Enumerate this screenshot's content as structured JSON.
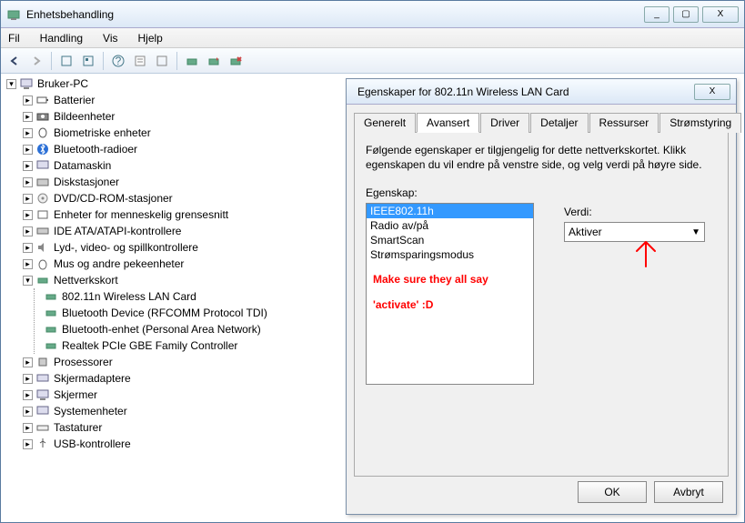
{
  "main": {
    "title": "Enhetsbehandling",
    "menu": {
      "fil": "Fil",
      "handling": "Handling",
      "vis": "Vis",
      "hjelp": "Hjelp"
    },
    "win_btns": {
      "min": "_",
      "max": "▢",
      "close": "X"
    }
  },
  "tree": {
    "root": "Bruker-PC",
    "batterier": "Batterier",
    "bildeenheter": "Bildeenheter",
    "biometriske": "Biometriske enheter",
    "bluetooth_radioer": "Bluetooth-radioer",
    "datamaskin": "Datamaskin",
    "diskstasjoner": "Diskstasjoner",
    "dvd": "DVD/CD-ROM-stasjoner",
    "hid": "Enheter for menneskelig grensesnitt",
    "ide": "IDE ATA/ATAPI-kontrollere",
    "lyd": "Lyd-, video- og spillkontrollere",
    "mus": "Mus og andre pekeenheter",
    "nettverkskort": "Nettverkskort",
    "net0": "802.11n Wireless LAN Card",
    "net1": "Bluetooth Device (RFCOMM Protocol TDI)",
    "net2": "Bluetooth-enhet (Personal Area Network)",
    "net3": "Realtek PCIe GBE Family Controller",
    "prosessorer": "Prosessorer",
    "skjermadaptere": "Skjermadaptere",
    "skjermer": "Skjermer",
    "systemenheter": "Systemenheter",
    "tastaturer": "Tastaturer",
    "usb": "USB-kontrollere"
  },
  "dialog": {
    "title": "Egenskaper for 802.11n Wireless LAN Card",
    "close": "X",
    "tabs": {
      "generelt": "Generelt",
      "avansert": "Avansert",
      "driver": "Driver",
      "detaljer": "Detaljer",
      "ressurser": "Ressurser",
      "strom": "Strømstyring"
    },
    "desc": "Følgende egenskaper er tilgjengelig for dette nettverkskortet. Klikk egenskapen du vil endre på venstre side, og velg verdi på høyre side.",
    "prop_label": "Egenskap:",
    "props": {
      "p0": "IEEE802.11h",
      "p1": "Radio av/på",
      "p2": "SmartScan",
      "p3": "Strømsparingsmodus"
    },
    "val_label": "Verdi:",
    "val": "Aktiver",
    "ok": "OK",
    "avbryt": "Avbryt"
  },
  "annotation": {
    "line1": "Make sure they all say",
    "line2": "'activate' :D",
    "arrow": "↑"
  }
}
